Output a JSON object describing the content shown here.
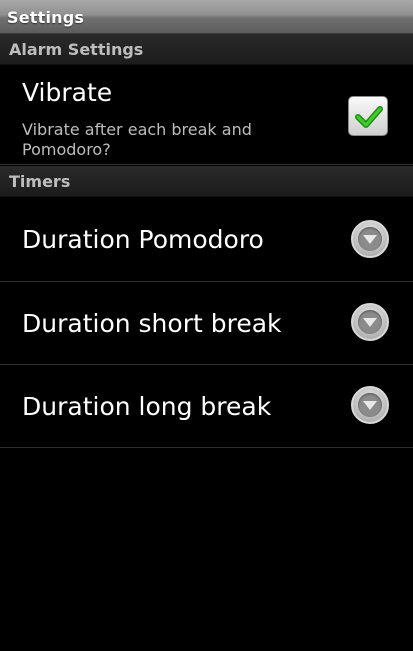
{
  "titlebar": {
    "title": "Settings"
  },
  "sections": {
    "alarm": {
      "header": "Alarm Settings"
    },
    "timers": {
      "header": "Timers"
    }
  },
  "vibrate": {
    "title": "Vibrate",
    "summary": "Vibrate after each break and Pomodoro?",
    "checked": true,
    "icon": "checkbox-checked-icon"
  },
  "timers": {
    "items": [
      {
        "title": "Duration Pomodoro",
        "icon": "chevron-down-icon"
      },
      {
        "title": "Duration short break",
        "icon": "chevron-down-icon"
      },
      {
        "title": "Duration long break",
        "icon": "chevron-down-icon"
      }
    ]
  },
  "colors": {
    "background": "#000000",
    "title_bar": "#8f8f8f",
    "section_header_text": "#bdbdbd",
    "check_mark": "#2fae1f"
  }
}
